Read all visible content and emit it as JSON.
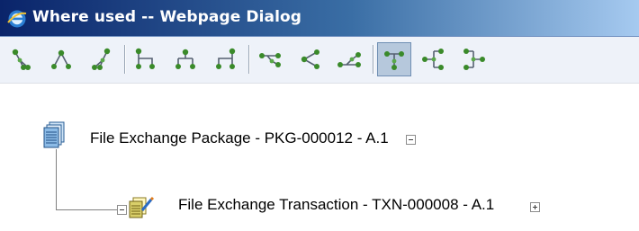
{
  "window": {
    "title": "Where used -- Webpage Dialog",
    "app_icon": "ie-icon"
  },
  "toolbar": {
    "buttons": [
      {
        "icon": "tree-layout-down-right-icon",
        "active": false
      },
      {
        "icon": "tree-layout-down-center-icon",
        "active": false
      },
      {
        "icon": "tree-layout-down-left-icon",
        "active": false
      },
      {
        "icon": "tree-layout-org-right-icon",
        "active": false
      },
      {
        "icon": "tree-layout-org-center-icon",
        "active": false
      },
      {
        "icon": "tree-layout-org-left-icon",
        "active": false
      },
      {
        "icon": "tree-layout-horizontal-right-icon",
        "active": false
      },
      {
        "icon": "tree-layout-horizontal-center-icon",
        "active": false
      },
      {
        "icon": "tree-layout-horizontal-left-icon",
        "active": false
      },
      {
        "icon": "tree-layout-vertical-active-icon",
        "active": true
      },
      {
        "icon": "tree-layout-vertical-left-icon",
        "active": false
      },
      {
        "icon": "tree-layout-vertical-right-icon",
        "active": false
      }
    ],
    "colors": {
      "node": "#3a8a2a",
      "line": "#556070",
      "active_bg": "#b6c8dc"
    }
  },
  "tree": {
    "root": {
      "label": "File Exchange Package - PKG-000012 - A.1",
      "icon": "package-document-icon",
      "expander": "collapse"
    },
    "child": {
      "label": "File Exchange Transaction - TXN-000008 - A.1",
      "icon": "transaction-document-icon",
      "left_expander": "collapse",
      "expander": "expand"
    }
  }
}
